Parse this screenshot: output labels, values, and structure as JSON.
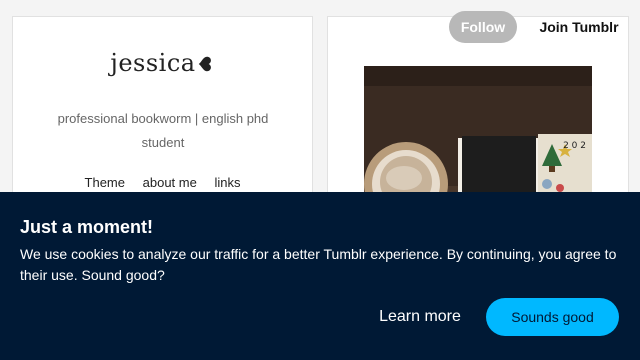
{
  "header": {
    "follow_label": "Follow",
    "join_label": "Join Tumblr"
  },
  "blog": {
    "title": "jessica",
    "description": "professional bookworm | english phd student",
    "nav": [
      {
        "label": "Theme"
      },
      {
        "label": "about me"
      },
      {
        "label": "links"
      }
    ]
  },
  "post": {
    "image_icon": "photo-of-coffee-and-book",
    "calendar_year_fragment": "2 0 2"
  },
  "cookie_banner": {
    "title": "Just a moment!",
    "message": "We use cookies to analyze our traffic for a better Tumblr experience. By continuing, you agree to their use. Sound good?",
    "learn_more_label": "Learn more",
    "accept_label": "Sounds good"
  },
  "colors": {
    "banner_bg": "#001935",
    "accent": "#00b8ff",
    "follow_bg": "#b8b8b8"
  }
}
